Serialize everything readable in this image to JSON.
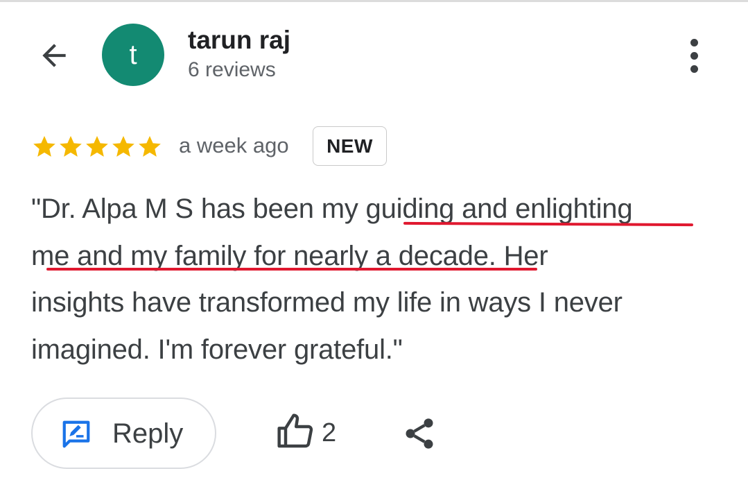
{
  "header": {
    "back_icon": "arrow-left-icon",
    "avatar_letter": "t",
    "avatar_color": "#138a72",
    "author_name": "tarun raj",
    "author_reviews": "6 reviews",
    "more_icon": "more-vertical-icon"
  },
  "review": {
    "rating": 5,
    "rating_max": 5,
    "star_color": "#f5b800",
    "time": "a week ago",
    "badge": "NEW",
    "text_lines": [
      "\"Dr. Alpa M S has been my guiding and enlighting",
      "me and my family for nearly a decade. Her",
      "insights have transformed my life in ways I never",
      "imagined. I'm forever grateful.\""
    ],
    "highlight_color": "#e0182f"
  },
  "actions": {
    "reply_label": "Reply",
    "reply_icon": "reply-edit-icon",
    "reply_icon_color": "#1a73e8",
    "like_icon": "thumbs-up-icon",
    "like_count": "2",
    "share_icon": "share-icon"
  }
}
